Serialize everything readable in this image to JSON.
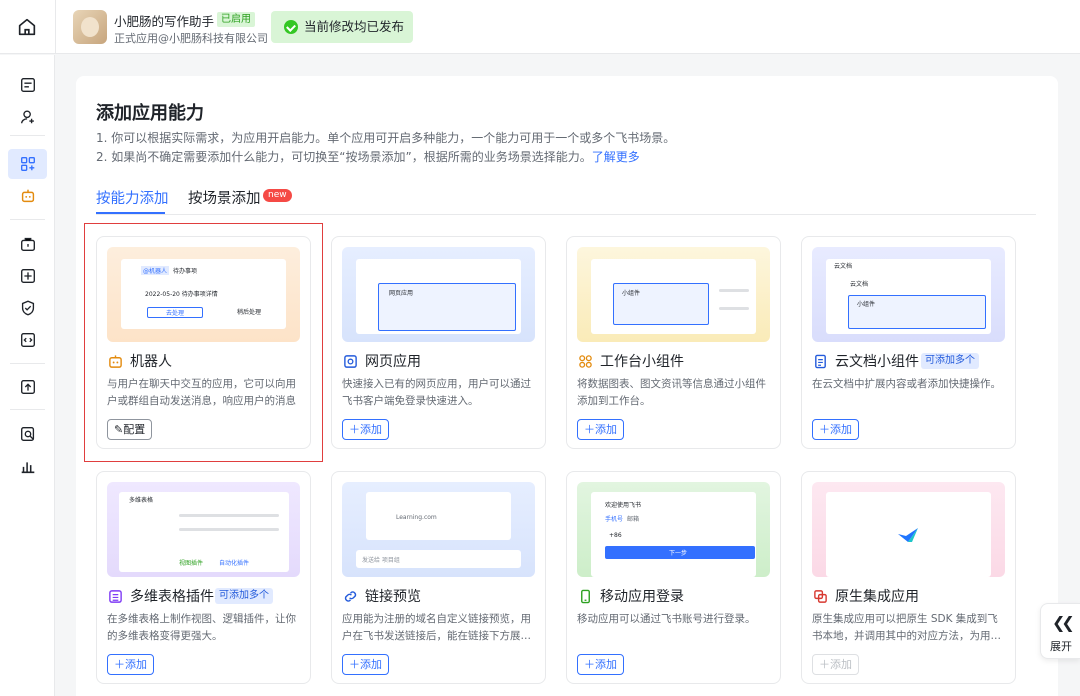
{
  "header": {
    "app_name": "小肥肠的写作助手",
    "status_badge": "已启用",
    "subtitle": "正式应用@小肥肠科技有限公司",
    "publish_status": "当前修改均已发布"
  },
  "page": {
    "title": "添加应用能力",
    "desc1": "1. 你可以根据实际需求，为应用开启能力。单个应用可开启多种能力，一个能力可用于一个或多个飞书场景。",
    "desc2": "2. 如果尚不确定需要添加什么能力，可切换至“按场景添加”，根据所需的业务场景选择能力。",
    "learn_more": "了解更多"
  },
  "tabs": {
    "by_capability": "按能力添加",
    "by_scene": "按场景添加",
    "new_badge": "new"
  },
  "cards": [
    {
      "title": "机器人",
      "desc": "与用户在聊天中交互的应用，它可以向用户或群组自动发送消息，响应用户的消息",
      "button": "配置",
      "icon": "robot-icon"
    },
    {
      "title": "网页应用",
      "desc": "快速接入已有的网页应用，用户可以通过飞书客户端免登录快速进入。",
      "button": "添加",
      "icon": "web-app-icon"
    },
    {
      "title": "工作台小组件",
      "desc": "将数据图表、图文资讯等信息通过小组件添加到工作台。",
      "button": "添加",
      "icon": "widget-icon"
    },
    {
      "title": "云文档小组件",
      "badge": "可添加多个",
      "desc": "在云文档中扩展内容或者添加快捷操作。",
      "button": "添加",
      "icon": "doc-icon"
    },
    {
      "title": "多维表格插件",
      "badge": "可添加多个",
      "desc": "在多维表格上制作视图、逻辑插件，让你的多维表格变得更强大。",
      "button": "添加",
      "icon": "base-icon"
    },
    {
      "title": "链接预览",
      "desc": "应用能为注册的域名自定义链接预览，用户在飞书发送链接后，能在链接下方展示应用自定义的内容",
      "button": "添加",
      "icon": "link-icon"
    },
    {
      "title": "移动应用登录",
      "desc": "移动应用可以通过飞书账号进行登录。",
      "button": "添加",
      "icon": "mobile-icon"
    },
    {
      "title": "原生集成应用",
      "desc": "原生集成应用可以把原生 SDK 集成到飞书本地，并调用其中的对应方法，为用户提供服务",
      "button": "添加",
      "icon": "native-icon",
      "disabled": true
    }
  ],
  "thumbs": {
    "bot_chat_name": "@机器人",
    "bot_chat_msg": "待办事项",
    "bot_date": "2022-05-20 待办事项详情",
    "bot_btn1": "去处理",
    "bot_btn2": "稍后处理",
    "web_label": "网页应用",
    "widget_label": "小组件",
    "doc_header": "云文档",
    "doc_title": "云文档",
    "doc_widget": "小组件",
    "base_title": "多维表格",
    "base_btn1": "视图插件",
    "base_btn2": "自动化插件",
    "link_msg": "Learning.com",
    "link_input": "发送给 项目组",
    "login_title": "欢迎使用飞书",
    "login_tab1": "手机号",
    "login_tab2": "邮箱",
    "login_prefix": "+86",
    "login_btn": "下一步"
  },
  "expand": {
    "label": "展开"
  },
  "colors": {
    "accent": "#3370ff",
    "success": "#34c724",
    "danger": "#f54a45"
  }
}
